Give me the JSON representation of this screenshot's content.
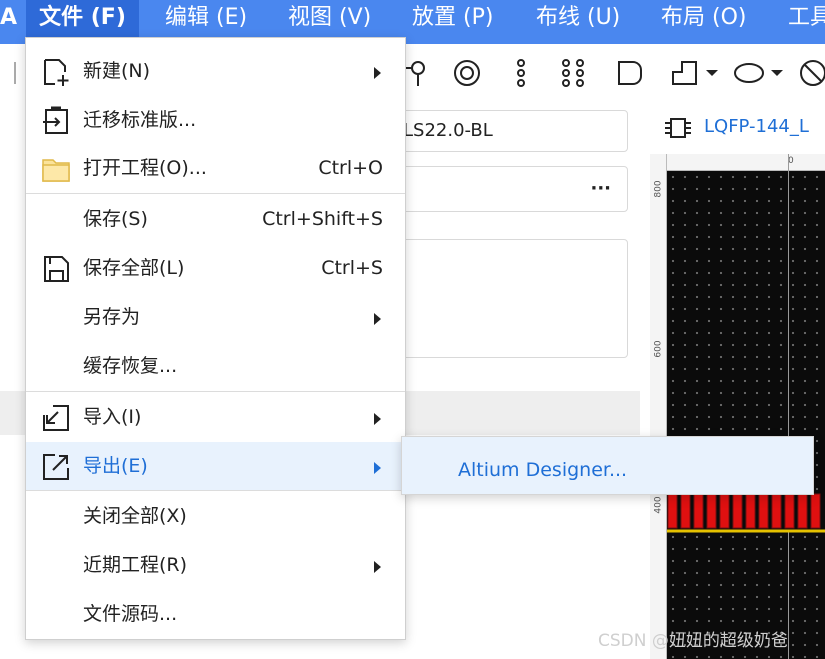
{
  "menubar": {
    "logo": "A",
    "items": [
      {
        "label": "文件 (F)"
      },
      {
        "label": "编辑 (E)"
      },
      {
        "label": "视图 (V)"
      },
      {
        "label": "放置 (P)"
      },
      {
        "label": "布线 (U)"
      },
      {
        "label": "布局 (O)"
      },
      {
        "label": "工具"
      }
    ]
  },
  "toolbar": {
    "icons": [
      "pin-icon",
      "ring-icon",
      "dots-vertical-icon",
      "dots-grid-icon",
      "rounded-rect-icon",
      "polyline-icon",
      "ellipse-icon",
      "no-entry-icon"
    ]
  },
  "panel": {
    "field1_value": "LS22.0-BL",
    "field2_more": "···"
  },
  "canvas": {
    "tab_label": "LQFP-144_L",
    "ruler_top": "0",
    "ruler_left": [
      "800",
      "600",
      "400"
    ],
    "colors": {
      "pads": "#e01010",
      "line": "#e6c200",
      "bg": "#0b0b0b"
    }
  },
  "file_menu": {
    "items": [
      {
        "label": "新建(N)",
        "shortcut": "",
        "icon": "new-file-icon"
      },
      {
        "label": "迁移标准版...",
        "shortcut": "",
        "icon": "migrate-icon"
      },
      {
        "label": "打开工程(O)...",
        "shortcut": "Ctrl+O",
        "icon": "folder-icon"
      },
      {
        "label": "保存(S)",
        "shortcut": "Ctrl+Shift+S",
        "icon": ""
      },
      {
        "label": "保存全部(L)",
        "shortcut": "Ctrl+S",
        "icon": "save-icon"
      },
      {
        "label": "另存为",
        "shortcut": "",
        "icon": ""
      },
      {
        "label": "缓存恢复...",
        "shortcut": "",
        "icon": ""
      },
      {
        "label": "导入(I)",
        "shortcut": "",
        "icon": "import-icon"
      },
      {
        "label": "导出(E)",
        "shortcut": "",
        "icon": "export-icon"
      },
      {
        "label": "关闭全部(X)",
        "shortcut": "",
        "icon": ""
      },
      {
        "label": "近期工程(R)",
        "shortcut": "",
        "icon": ""
      },
      {
        "label": "文件源码...",
        "shortcut": "",
        "icon": ""
      }
    ]
  },
  "export_submenu": {
    "items": [
      {
        "label": "Altium Designer..."
      }
    ]
  },
  "watermark": "CSDN @妞妞的超级奶爸",
  "accent": "#4a87ef"
}
